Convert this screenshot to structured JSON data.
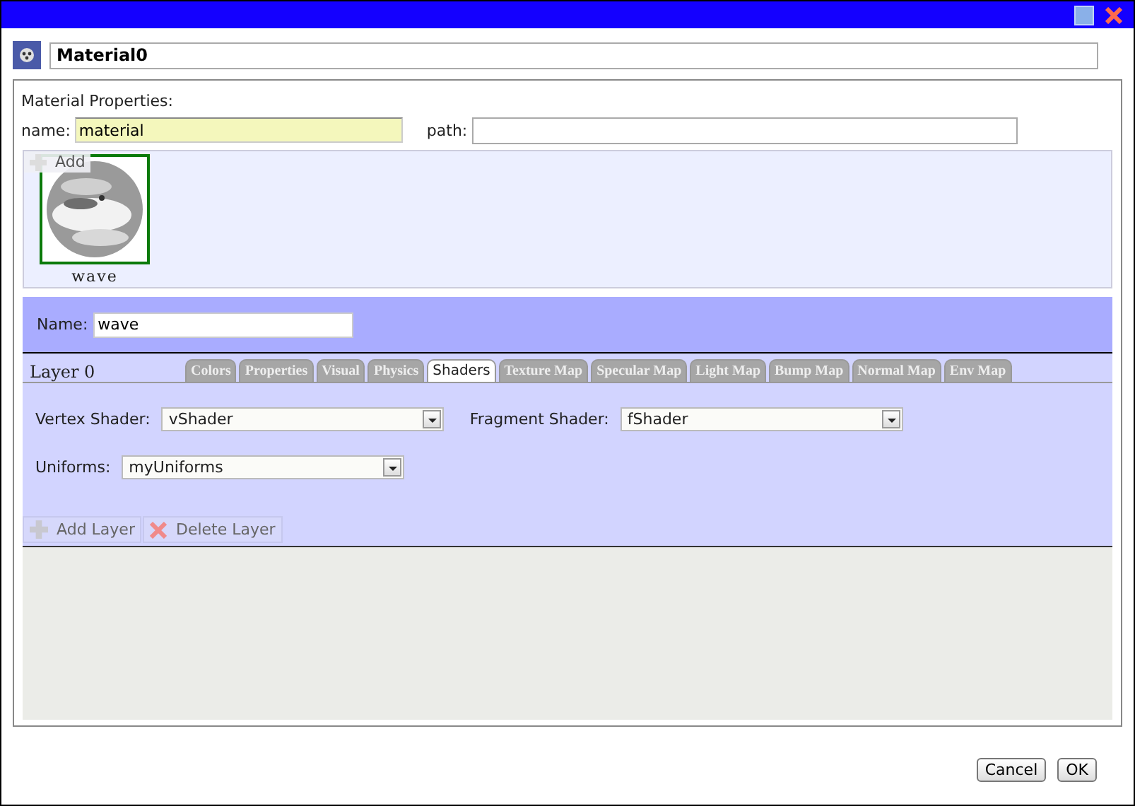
{
  "header": {
    "title": "Material0"
  },
  "material_properties": {
    "heading": "Material Properties:",
    "name_label": "name:",
    "name_value": "material",
    "path_label": "path:"
  },
  "layers_strip": {
    "add_button": "Add",
    "items": [
      {
        "label": "wave",
        "selected": true,
        "kind": "picture"
      }
    ]
  },
  "layer_name": {
    "label": "Name:",
    "value": "wave"
  },
  "layer_panel": {
    "title": "Layer 0",
    "tabs": [
      {
        "label": "Colors",
        "selected": false
      },
      {
        "label": "Properties",
        "selected": false
      },
      {
        "label": "Visual",
        "selected": false
      },
      {
        "label": "Physics",
        "selected": false
      },
      {
        "label": "Shaders",
        "selected": true
      },
      {
        "label": "Texture Map",
        "selected": false
      },
      {
        "label": "Specular Map",
        "selected": false
      },
      {
        "label": "Light Map",
        "selected": false
      },
      {
        "label": "Bump Map",
        "selected": false
      },
      {
        "label": "Normal Map",
        "selected": false
      },
      {
        "label": "Env Map",
        "selected": false
      }
    ],
    "vertex_shader": {
      "label": "Vertex Shader:",
      "value": "vShader"
    },
    "fragment_shader": {
      "label": "Fragment Shader:",
      "value": "fShader"
    },
    "uniforms": {
      "label": "Uniforms:",
      "value": "myUniforms"
    },
    "toolbar": [
      "Add Layer",
      "Delete Layer"
    ]
  },
  "footer": {
    "buttons": [
      "Cancel",
      "OK"
    ]
  }
}
